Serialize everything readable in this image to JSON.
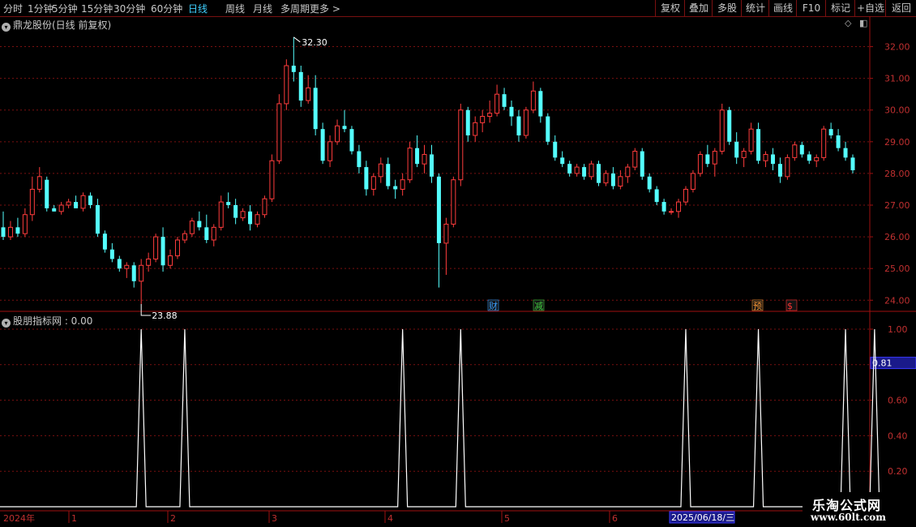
{
  "toolbar": {
    "periods": [
      "分时",
      "1分钟",
      "5分钟",
      "15分钟",
      "30分钟",
      "60分钟",
      "日线",
      "周线",
      "月线",
      "多周期",
      "更多 >"
    ],
    "active": "日线",
    "right_buttons": [
      "复权",
      "叠加",
      "多股",
      "统计",
      "画线",
      "F10",
      "标记",
      "+自选",
      "返回"
    ]
  },
  "stock": {
    "title": "鼎龙股份(日线 前复权)",
    "high_label": "32.30",
    "low_label": "23.88",
    "price_ticks": [
      "32.00",
      "31.00",
      "30.00",
      "29.00",
      "28.00",
      "27.00",
      "26.00",
      "25.00",
      "24.00"
    ],
    "event_tags": [
      {
        "text": "财",
        "color": "#3aa0ff"
      },
      {
        "text": "减",
        "color": "#40d040"
      },
      {
        "text": "预",
        "color": "#ff9933"
      },
      {
        "text": "$",
        "color": "#ff3333"
      }
    ]
  },
  "indicator": {
    "title": "股朋指标网 : 0.00",
    "ticks": [
      "1.00",
      "0.80",
      "0.60",
      "0.40",
      "0.20"
    ],
    "cursor_value": "0.81"
  },
  "timeline": {
    "labels": [
      "2024年",
      "1",
      "2",
      "3",
      "4",
      "5",
      "6"
    ],
    "highlight": "2025/06/18/三"
  },
  "watermark": {
    "line1": "乐淘公式网",
    "line2": "www.60lt.com"
  },
  "colors": {
    "up": "#ff3c3c",
    "down": "#54ffff",
    "grid": "#7a1010",
    "axis": "#a01010"
  },
  "chart_data": {
    "type": "candlestick",
    "price_range": [
      23.7,
      32.5
    ],
    "candles": [
      [
        26.3,
        26.8,
        25.9,
        26.0
      ],
      [
        26.0,
        26.5,
        25.9,
        26.3
      ],
      [
        26.3,
        26.6,
        26.0,
        26.1
      ],
      [
        26.1,
        26.9,
        26.0,
        26.7
      ],
      [
        26.7,
        27.9,
        26.5,
        27.5
      ],
      [
        27.5,
        28.2,
        27.4,
        27.9
      ],
      [
        27.8,
        27.9,
        26.8,
        26.9
      ],
      [
        26.9,
        27.0,
        26.8,
        26.8
      ],
      [
        26.8,
        27.1,
        26.7,
        27.0
      ],
      [
        27.0,
        27.2,
        26.9,
        27.1
      ],
      [
        27.1,
        27.3,
        26.9,
        26.9
      ],
      [
        26.9,
        27.4,
        26.8,
        27.3
      ],
      [
        27.3,
        27.4,
        26.9,
        27.0
      ],
      [
        27.0,
        27.2,
        26.0,
        26.1
      ],
      [
        26.1,
        26.2,
        25.5,
        25.6
      ],
      [
        25.6,
        25.8,
        25.2,
        25.3
      ],
      [
        25.3,
        25.4,
        24.9,
        25.0
      ],
      [
        25.0,
        25.2,
        24.7,
        25.1
      ],
      [
        25.1,
        25.2,
        24.4,
        24.6
      ],
      [
        24.6,
        25.3,
        23.88,
        25.1
      ],
      [
        25.1,
        25.5,
        24.9,
        25.3
      ],
      [
        25.3,
        26.1,
        25.2,
        26.0
      ],
      [
        26.0,
        26.3,
        24.9,
        25.1
      ],
      [
        25.1,
        25.6,
        25.0,
        25.4
      ],
      [
        25.4,
        26.0,
        25.3,
        25.9
      ],
      [
        25.9,
        26.2,
        25.8,
        26.1
      ],
      [
        26.1,
        26.6,
        26.0,
        26.5
      ],
      [
        26.5,
        26.8,
        26.2,
        26.3
      ],
      [
        26.3,
        26.7,
        25.8,
        25.9
      ],
      [
        25.9,
        26.4,
        25.7,
        26.3
      ],
      [
        26.3,
        27.3,
        26.2,
        27.1
      ],
      [
        27.1,
        27.4,
        26.9,
        27.0
      ],
      [
        27.0,
        27.2,
        26.4,
        26.6
      ],
      [
        26.6,
        26.9,
        26.5,
        26.8
      ],
      [
        26.8,
        27.0,
        26.2,
        26.4
      ],
      [
        26.4,
        26.8,
        26.3,
        26.7
      ],
      [
        26.7,
        27.3,
        26.6,
        27.2
      ],
      [
        27.2,
        28.6,
        27.1,
        28.4
      ],
      [
        28.4,
        30.5,
        28.3,
        30.2
      ],
      [
        30.2,
        31.6,
        30.0,
        31.4
      ],
      [
        31.4,
        32.3,
        30.9,
        31.2
      ],
      [
        31.2,
        31.4,
        30.1,
        30.3
      ],
      [
        30.3,
        31.1,
        30.2,
        30.7
      ],
      [
        30.7,
        31.1,
        29.2,
        29.4
      ],
      [
        29.4,
        29.6,
        28.3,
        28.4
      ],
      [
        28.4,
        29.2,
        28.2,
        29.0
      ],
      [
        29.0,
        29.7,
        28.9,
        29.5
      ],
      [
        29.5,
        30.0,
        29.3,
        29.4
      ],
      [
        29.4,
        29.5,
        28.6,
        28.7
      ],
      [
        28.7,
        28.9,
        28.0,
        28.2
      ],
      [
        28.2,
        28.4,
        27.3,
        27.5
      ],
      [
        27.5,
        28.0,
        27.3,
        27.9
      ],
      [
        27.9,
        28.5,
        27.7,
        28.3
      ],
      [
        28.3,
        28.5,
        27.5,
        27.6
      ],
      [
        27.6,
        27.8,
        27.2,
        27.5
      ],
      [
        27.5,
        28.0,
        27.3,
        27.8
      ],
      [
        27.8,
        29.0,
        27.7,
        28.8
      ],
      [
        28.8,
        29.2,
        28.2,
        28.3
      ],
      [
        28.3,
        28.9,
        28.0,
        28.6
      ],
      [
        28.6,
        28.9,
        27.7,
        27.9
      ],
      [
        27.9,
        28.0,
        24.4,
        25.8
      ],
      [
        25.8,
        26.6,
        24.8,
        26.4
      ],
      [
        26.4,
        27.9,
        26.3,
        27.8
      ],
      [
        27.8,
        30.2,
        27.6,
        30.0
      ],
      [
        30.0,
        30.1,
        29.0,
        29.2
      ],
      [
        29.2,
        29.8,
        29.0,
        29.6
      ],
      [
        29.6,
        30.0,
        29.3,
        29.8
      ],
      [
        29.8,
        30.3,
        29.6,
        29.9
      ],
      [
        29.9,
        30.8,
        29.8,
        30.5
      ],
      [
        30.5,
        30.7,
        30.0,
        30.1
      ],
      [
        30.1,
        30.3,
        29.5,
        29.8
      ],
      [
        29.8,
        30.0,
        29.0,
        29.2
      ],
      [
        29.2,
        30.1,
        29.1,
        30.0
      ],
      [
        30.0,
        30.9,
        29.9,
        30.6
      ],
      [
        30.6,
        30.7,
        29.6,
        29.8
      ],
      [
        29.8,
        29.9,
        28.9,
        29.0
      ],
      [
        29.0,
        29.2,
        28.4,
        28.5
      ],
      [
        28.5,
        28.7,
        28.2,
        28.3
      ],
      [
        28.3,
        28.4,
        27.9,
        28.0
      ],
      [
        28.0,
        28.3,
        27.9,
        28.2
      ],
      [
        28.2,
        28.3,
        27.8,
        27.9
      ],
      [
        27.9,
        28.4,
        27.8,
        28.3
      ],
      [
        28.3,
        28.4,
        27.6,
        27.7
      ],
      [
        27.7,
        28.1,
        27.6,
        28.0
      ],
      [
        28.0,
        28.2,
        27.5,
        27.6
      ],
      [
        27.6,
        28.1,
        27.5,
        27.9
      ],
      [
        27.9,
        28.3,
        27.7,
        28.2
      ],
      [
        28.2,
        28.8,
        28.1,
        28.7
      ],
      [
        28.7,
        28.8,
        27.8,
        27.9
      ],
      [
        27.9,
        28.0,
        27.4,
        27.5
      ],
      [
        27.5,
        27.6,
        27.0,
        27.1
      ],
      [
        27.1,
        27.2,
        26.7,
        26.8
      ],
      [
        26.8,
        26.9,
        26.7,
        26.8
      ],
      [
        26.8,
        27.2,
        26.6,
        27.1
      ],
      [
        27.1,
        27.6,
        27.0,
        27.5
      ],
      [
        27.5,
        28.1,
        27.4,
        28.0
      ],
      [
        28.0,
        28.7,
        27.9,
        28.6
      ],
      [
        28.6,
        28.9,
        28.2,
        28.3
      ],
      [
        28.3,
        28.8,
        27.9,
        28.7
      ],
      [
        28.7,
        30.2,
        28.6,
        30.0
      ],
      [
        30.0,
        30.1,
        28.9,
        29.0
      ],
      [
        29.0,
        29.3,
        28.3,
        28.5
      ],
      [
        28.5,
        28.8,
        28.2,
        28.7
      ],
      [
        28.7,
        29.6,
        28.6,
        29.4
      ],
      [
        29.4,
        29.6,
        28.3,
        28.4
      ],
      [
        28.4,
        28.7,
        28.2,
        28.6
      ],
      [
        28.6,
        28.8,
        28.1,
        28.3
      ],
      [
        28.3,
        28.5,
        27.7,
        27.9
      ],
      [
        27.9,
        28.6,
        27.8,
        28.5
      ],
      [
        28.5,
        29.0,
        28.4,
        28.9
      ],
      [
        28.9,
        29.0,
        28.5,
        28.6
      ],
      [
        28.6,
        28.7,
        28.3,
        28.4
      ],
      [
        28.4,
        28.6,
        28.2,
        28.5
      ],
      [
        28.5,
        29.5,
        28.4,
        29.4
      ],
      [
        29.4,
        29.6,
        29.1,
        29.2
      ],
      [
        29.2,
        29.4,
        28.7,
        28.8
      ],
      [
        28.8,
        29.0,
        28.4,
        28.5
      ],
      [
        28.5,
        28.6,
        28.0,
        28.1
      ]
    ],
    "indicator_spikes_at_index": [
      19,
      25,
      55,
      63,
      94,
      104,
      116,
      120
    ],
    "indicator_range": [
      0,
      1
    ]
  }
}
